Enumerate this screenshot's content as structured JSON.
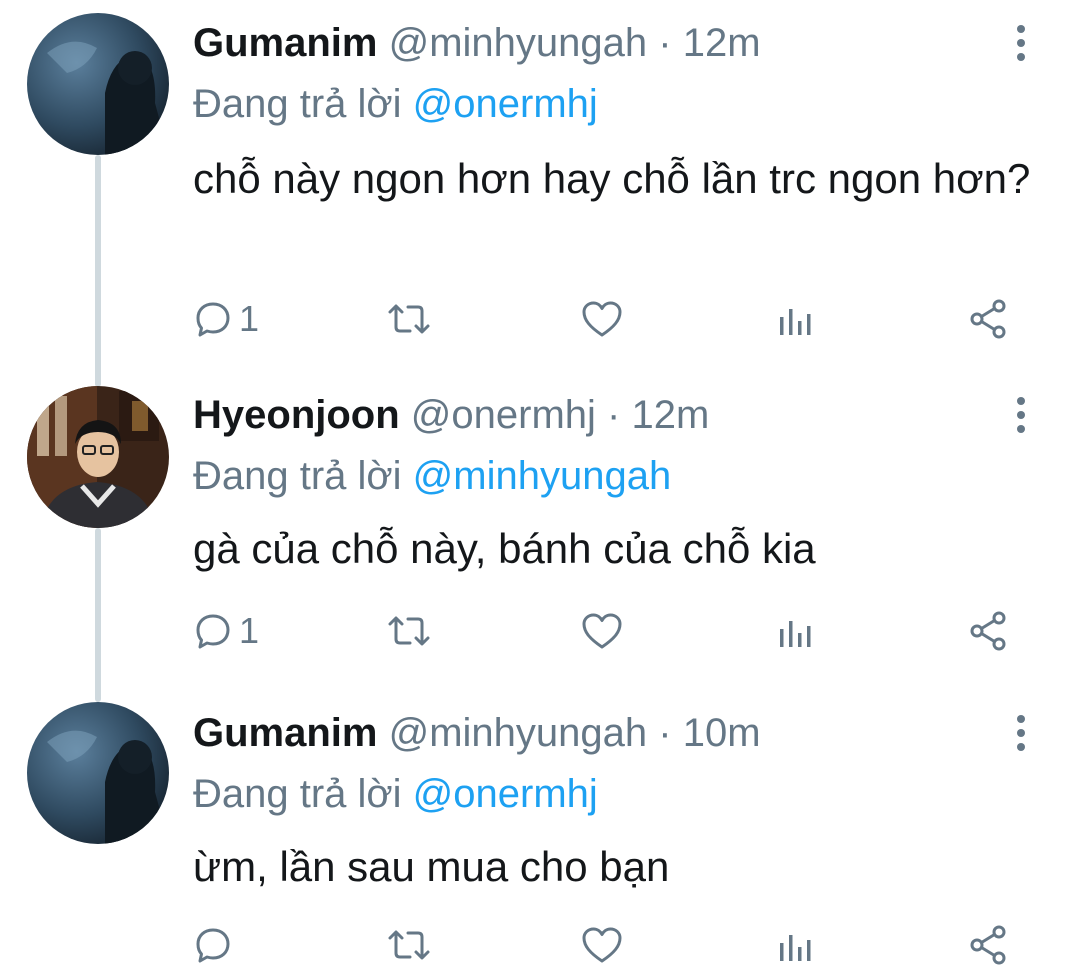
{
  "tweets": [
    {
      "name": "Gumanim",
      "handle": "@minhyungah",
      "separator": "·",
      "time": "12m",
      "replying_prefix": "Đang trả lời",
      "replying_to": "@onermhj",
      "text": "chỗ này ngon hơn hay chỗ lần trc ngon hơn?",
      "reply_count": "1",
      "retweet_count": "",
      "like_count": ""
    },
    {
      "name": "Hyeonjoon",
      "handle": "@onermhj",
      "separator": "·",
      "time": "12m",
      "replying_prefix": "Đang trả lời",
      "replying_to": "@minhyungah",
      "text": "gà của chỗ này, bánh của chỗ kia",
      "reply_count": "1",
      "retweet_count": "",
      "like_count": ""
    },
    {
      "name": "Gumanim",
      "handle": "@minhyungah",
      "separator": "·",
      "time": "10m",
      "replying_prefix": "Đang trả lời",
      "replying_to": "@onermhj",
      "text": "ừm, lần sau mua cho bạn",
      "reply_count": "",
      "retweet_count": "",
      "like_count": ""
    }
  ],
  "icons": {
    "reply": "reply-icon",
    "retweet": "retweet-icon",
    "like": "heart-icon",
    "analytics": "analytics-icon",
    "share": "share-icon",
    "more": "more-vertical-icon"
  },
  "colors": {
    "name": "#14171a",
    "muted": "#657786",
    "mention": "#1da1f2",
    "thread_line": "#cfd9de"
  }
}
